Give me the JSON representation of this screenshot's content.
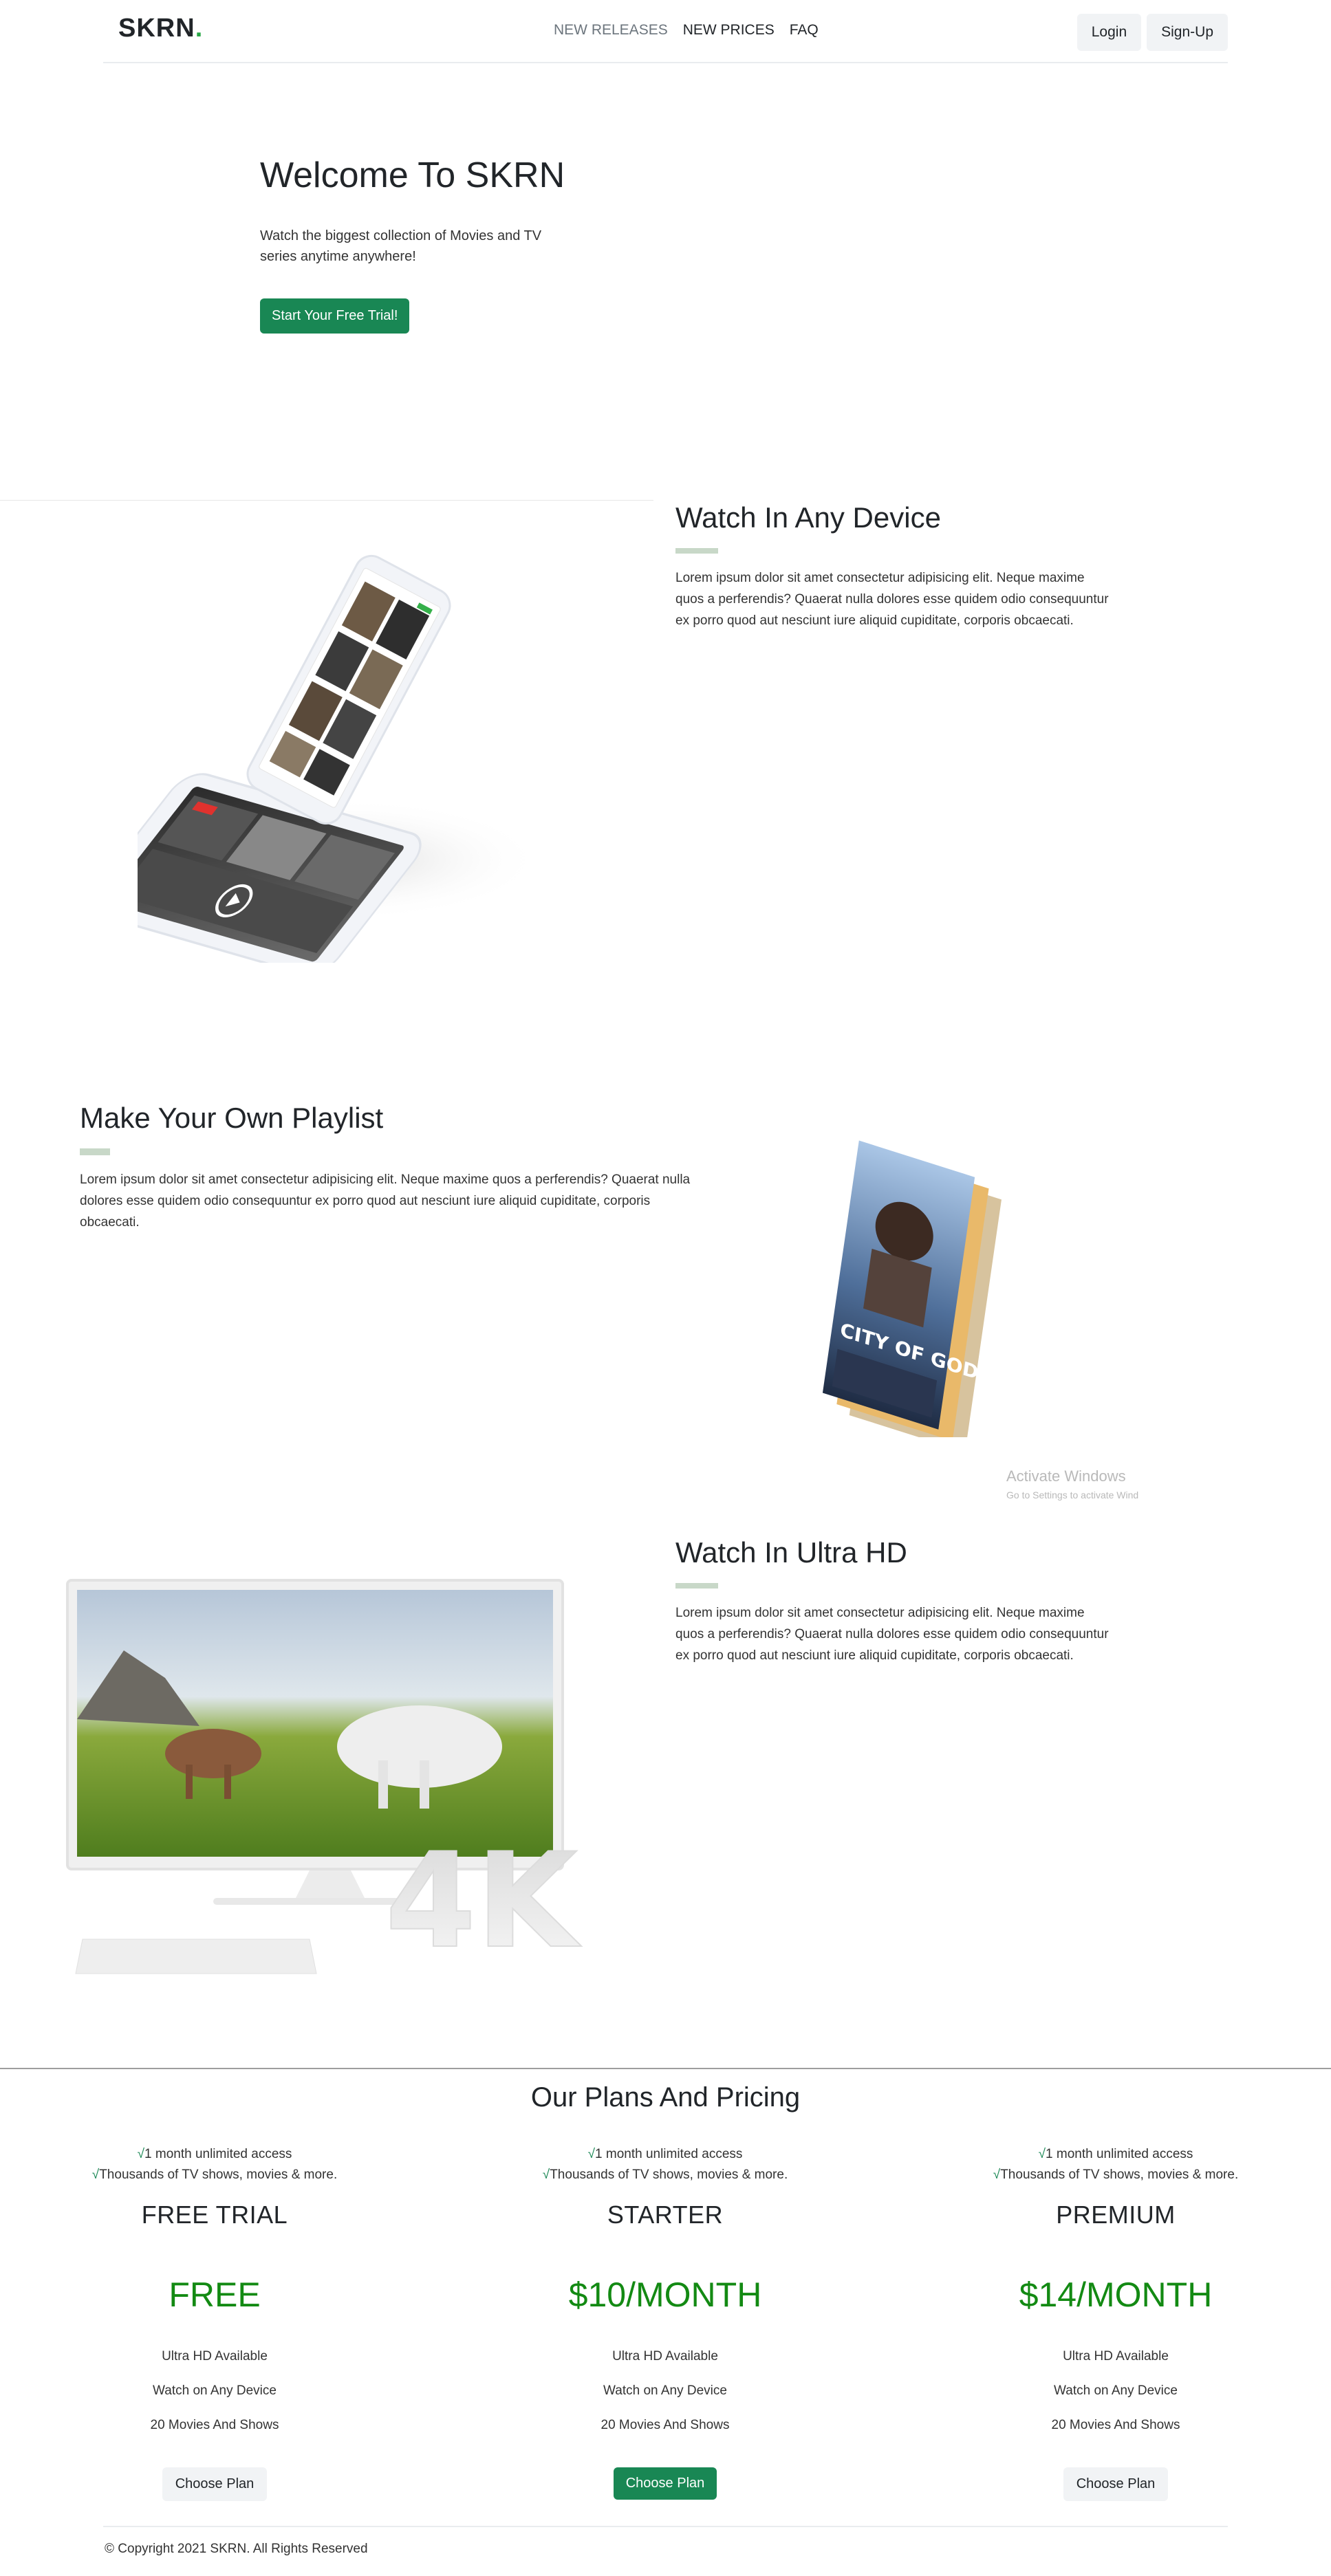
{
  "nav": {
    "brand": "SKRN",
    "brand_dot": ".",
    "links": [
      "NEW RELEASES",
      "NEW PRICES",
      "FAQ"
    ],
    "login": "Login",
    "signup": "Sign-Up"
  },
  "hero": {
    "title": "Welcome To SKRN",
    "subtitle": "Watch the biggest collection of Movies and TV series anytime anywhere!",
    "cta": "Start Your Free Trial!"
  },
  "features": [
    {
      "title": "Watch In Any Device",
      "text": "Lorem ipsum dolor sit amet consectetur adipisicing elit. Neque maxime quos a perferendis? Quaerat nulla dolores esse quidem odio consequuntur ex porro quod aut nesciunt iure aliquid cupiditate, corporis obcaecati."
    },
    {
      "title": "Make Your Own Playlist",
      "text": "Lorem ipsum dolor sit amet consectetur adipisicing elit. Neque maxime quos a perferendis? Quaerat nulla dolores esse quidem odio consequuntur ex porro quod aut nesciunt iure aliquid cupiditate, corporis obcaecati."
    },
    {
      "title": "Watch In Ultra HD",
      "text": "Lorem ipsum dolor sit amet consectetur adipisicing elit. Neque maxime quos a perferendis? Quaerat nulla dolores esse quidem odio consequuntur ex porro quod aut nesciunt iure aliquid cupiditate, corporis obcaecati."
    }
  ],
  "poster_text": "CITY OF GODS",
  "monitor_badge": "4K",
  "watermark": {
    "line1": "Activate Windows",
    "line2": "Go to Settings to activate Wind"
  },
  "pricing": {
    "title": "Our Plans And Pricing",
    "check": "√",
    "plans": [
      {
        "feature1": "1 month unlimited access",
        "feature2": "Thousands of TV shows, movies & more.",
        "name": "FREE TRIAL",
        "price": "FREE",
        "perks": [
          "Ultra HD Available",
          "Watch on Any Device",
          "20 Movies And Shows"
        ],
        "button": "Choose Plan"
      },
      {
        "feature1": "1 month unlimited access",
        "feature2": "Thousands of TV shows, movies & more.",
        "name": "STARTER",
        "price": "$10/MONTH",
        "perks": [
          "Ultra HD Available",
          "Watch on Any Device",
          "20 Movies And Shows"
        ],
        "button": "Choose Plan"
      },
      {
        "feature1": "1 month unlimited access",
        "feature2": "Thousands of TV shows, movies & more.",
        "name": "PREMIUM",
        "price": "$14/MONTH",
        "perks": [
          "Ultra HD Available",
          "Watch on Any Device",
          "20 Movies And Shows"
        ],
        "button": "Choose Plan"
      }
    ]
  },
  "footer": "© Copyright 2021 SKRN. All Rights Reserved",
  "colors": {
    "accent_green": "#198754",
    "price_green": "#138a13",
    "brand_dot": "#28a745",
    "feature_bar": "#c8d8c8"
  }
}
